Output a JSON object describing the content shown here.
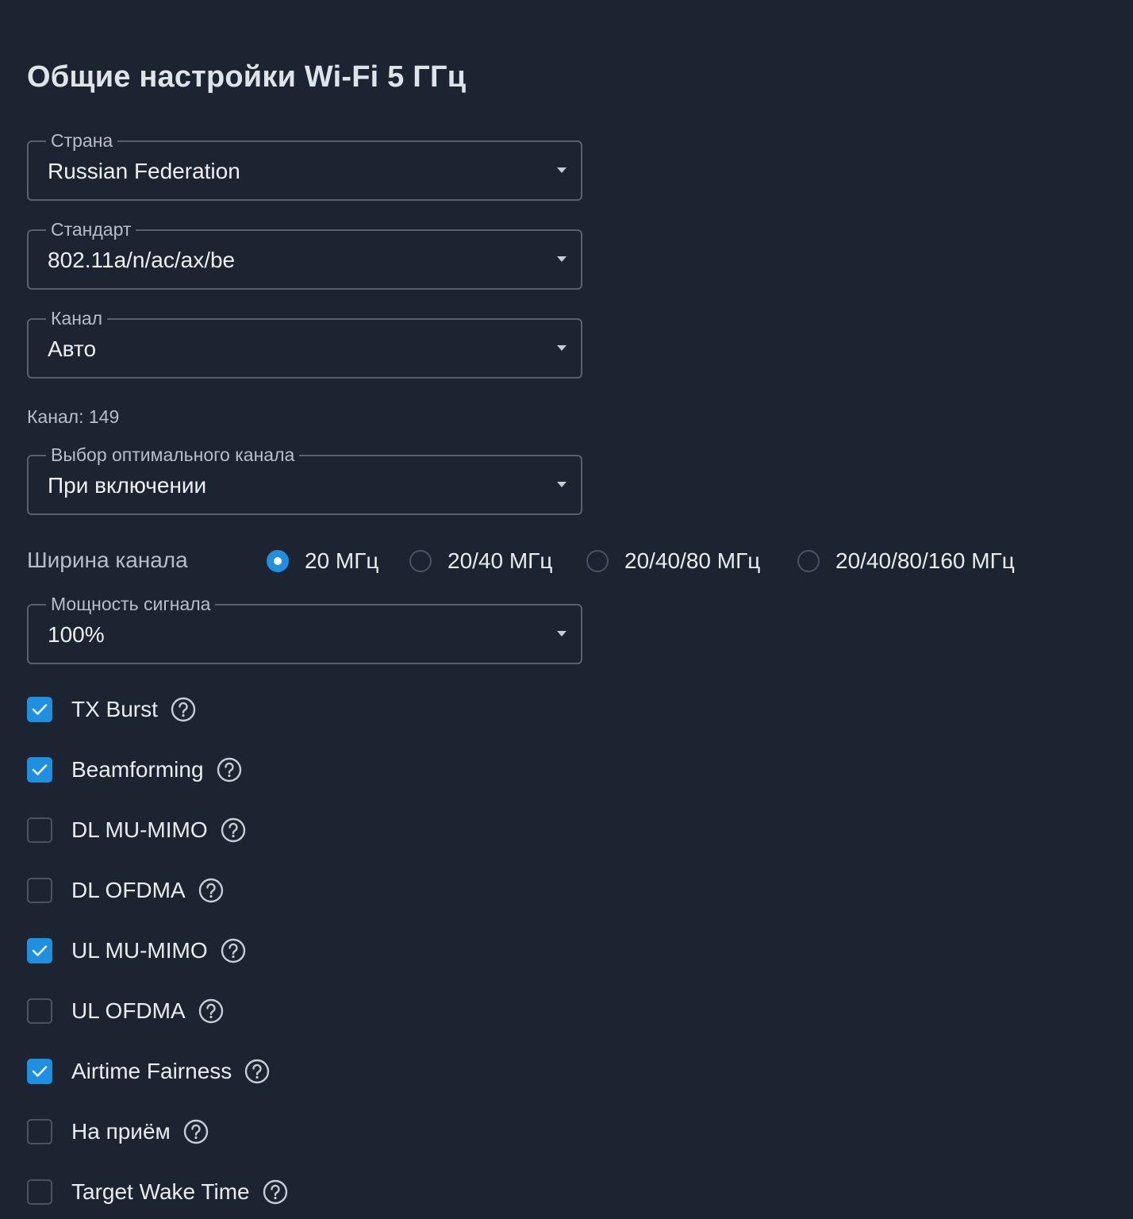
{
  "page": {
    "title": "Общие настройки Wi-Fi 5 ГГц"
  },
  "fields": {
    "country": {
      "label": "Страна",
      "value": "Russian Federation"
    },
    "standard": {
      "label": "Стандарт",
      "value": "802.11a/n/ac/ax/be"
    },
    "channel": {
      "label": "Канал",
      "value": "Авто"
    },
    "channel_hint": "Канал: 149",
    "optimal_channel": {
      "label": "Выбор оптимального канала",
      "value": "При включении"
    },
    "power": {
      "label": "Мощность сигнала",
      "value": "100%"
    }
  },
  "channel_width": {
    "label": "Ширина канала",
    "options": [
      {
        "label": "20 МГц",
        "selected": true
      },
      {
        "label": "20/40 МГц",
        "selected": false
      },
      {
        "label": "20/40/80 МГц",
        "selected": false
      },
      {
        "label": "20/40/80/160 МГц",
        "selected": false
      }
    ]
  },
  "checkboxes": [
    {
      "label": "TX Burst",
      "checked": true
    },
    {
      "label": "Beamforming",
      "checked": true
    },
    {
      "label": "DL MU-MIMO",
      "checked": false
    },
    {
      "label": "DL OFDMA",
      "checked": false
    },
    {
      "label": "UL MU-MIMO",
      "checked": true
    },
    {
      "label": "UL OFDMA",
      "checked": false
    },
    {
      "label": "Airtime Fairness",
      "checked": true
    },
    {
      "label": "На приём",
      "checked": false
    },
    {
      "label": "Target Wake Time",
      "checked": false
    }
  ],
  "colors": {
    "background": "#1c2331",
    "accent": "#1f8fe0",
    "border": "#59606e"
  }
}
